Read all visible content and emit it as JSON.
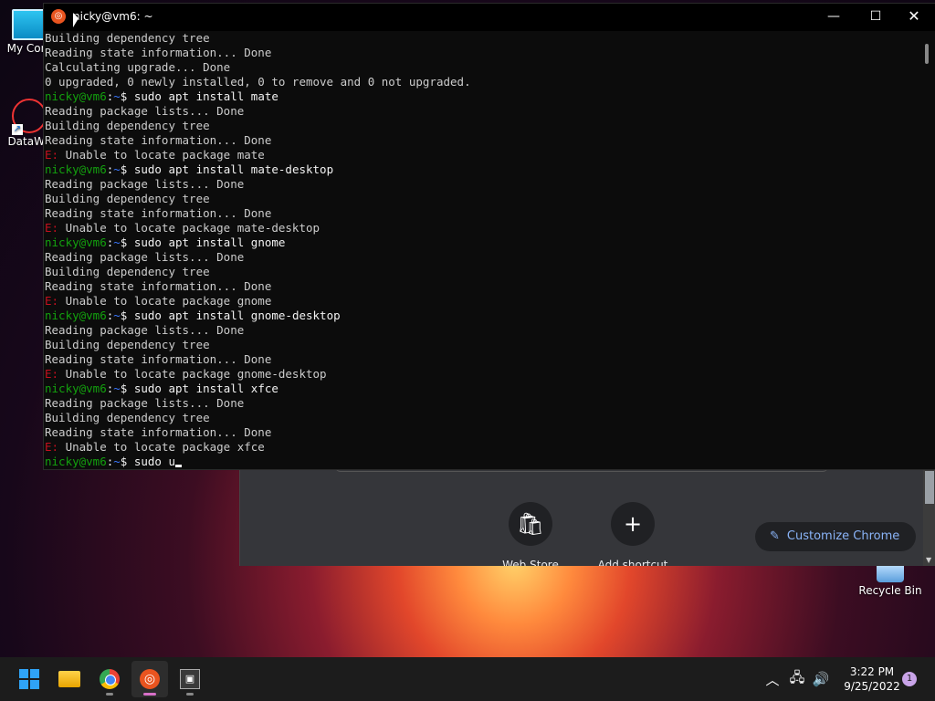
{
  "desktop": {
    "icons": [
      {
        "label": "My Com"
      },
      {
        "label": "DataWa"
      },
      {
        "label": "Recycle Bin"
      }
    ]
  },
  "chrome": {
    "shortcuts": [
      {
        "label": "Web Store",
        "icon": "chrome-webstore-icon"
      },
      {
        "label": "Add shortcut",
        "icon": "plus-icon"
      }
    ],
    "customize_label": "Customize Chrome",
    "accent": "#8ab4f8"
  },
  "terminal": {
    "title": "nicky@vm6: ~",
    "controls": {
      "minimize": "—",
      "maximize": "☐",
      "close": "✕"
    },
    "prompt_user": "nicky@vm6",
    "prompt_sep": ":",
    "prompt_path": "~",
    "prompt_dollar": "$ ",
    "error_prefix": "E:",
    "lines": [
      {
        "type": "out",
        "text": "Building dependency tree"
      },
      {
        "type": "out",
        "text": "Reading state information... Done"
      },
      {
        "type": "out",
        "text": "Calculating upgrade... Done"
      },
      {
        "type": "out",
        "text": "0 upgraded, 0 newly installed, 0 to remove and 0 not upgraded."
      },
      {
        "type": "cmd",
        "text": "sudo apt install mate"
      },
      {
        "type": "out",
        "text": "Reading package lists... Done"
      },
      {
        "type": "out",
        "text": "Building dependency tree"
      },
      {
        "type": "out",
        "text": "Reading state information... Done"
      },
      {
        "type": "err",
        "text": " Unable to locate package mate"
      },
      {
        "type": "cmd",
        "text": "sudo apt install mate-desktop"
      },
      {
        "type": "out",
        "text": "Reading package lists... Done"
      },
      {
        "type": "out",
        "text": "Building dependency tree"
      },
      {
        "type": "out",
        "text": "Reading state information... Done"
      },
      {
        "type": "err",
        "text": " Unable to locate package mate-desktop"
      },
      {
        "type": "cmd",
        "text": "sudo apt install gnome"
      },
      {
        "type": "out",
        "text": "Reading package lists... Done"
      },
      {
        "type": "out",
        "text": "Building dependency tree"
      },
      {
        "type": "out",
        "text": "Reading state information... Done"
      },
      {
        "type": "err",
        "text": " Unable to locate package gnome"
      },
      {
        "type": "cmd",
        "text": "sudo apt install gnome-desktop"
      },
      {
        "type": "out",
        "text": "Reading package lists... Done"
      },
      {
        "type": "out",
        "text": "Building dependency tree"
      },
      {
        "type": "out",
        "text": "Reading state information... Done"
      },
      {
        "type": "err",
        "text": " Unable to locate package gnome-desktop"
      },
      {
        "type": "cmd",
        "text": "sudo apt install xfce"
      },
      {
        "type": "out",
        "text": "Reading package lists... Done"
      },
      {
        "type": "out",
        "text": "Building dependency tree"
      },
      {
        "type": "out",
        "text": "Reading state information... Done"
      },
      {
        "type": "err",
        "text": " Unable to locate package xfce"
      }
    ],
    "current_input": "sudo u",
    "colors": {
      "prompt_user": "#13a10e",
      "prompt_path": "#3b78ff",
      "error": "#c50f1f",
      "text": "#cccccc"
    }
  },
  "taskbar": {
    "apps": [
      {
        "name": "start",
        "icon": "windows-start-icon"
      },
      {
        "name": "file-explorer",
        "icon": "folder-icon"
      },
      {
        "name": "chrome",
        "icon": "chrome-icon"
      },
      {
        "name": "ubuntu",
        "icon": "ubuntu-icon"
      },
      {
        "name": "app",
        "icon": "app-window-icon"
      }
    ],
    "tray": {
      "chevron": "︿",
      "network": "🖧",
      "volume": "🔊"
    },
    "time": "3:22 PM",
    "date": "9/25/2022",
    "notification_count": "1"
  }
}
